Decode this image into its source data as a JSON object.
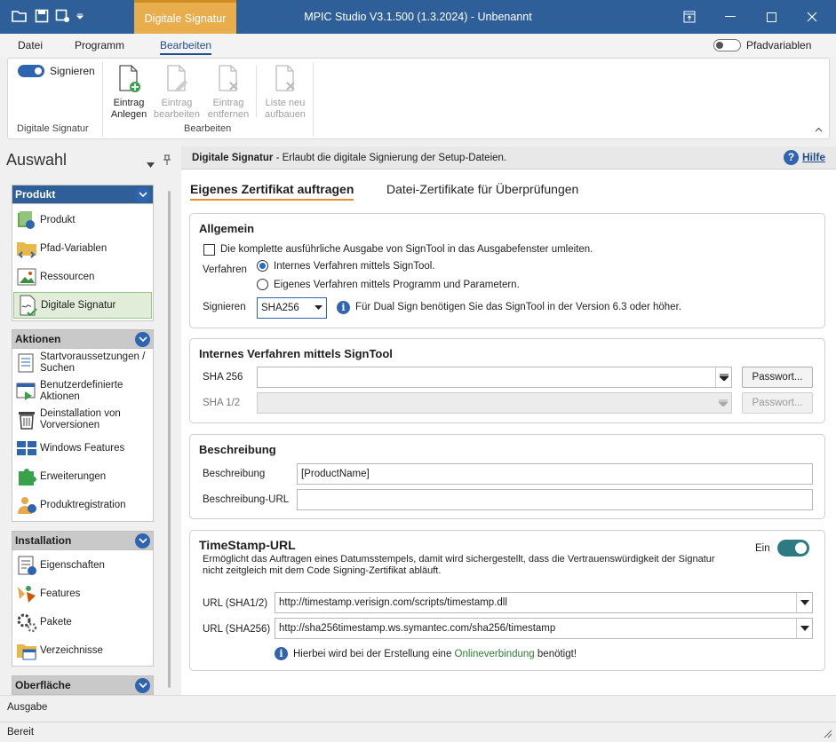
{
  "titlebar": {
    "context_tab": "Digitale Signatur",
    "app_title": "MPIC Studio V3.1.500 (1.3.2024) - Unbenannt"
  },
  "ribbon_tabs": [
    "Datei",
    "Programm",
    "Bearbeiten"
  ],
  "pfadvariablen_label": "Pfadvariablen",
  "ribbon": {
    "signieren_label": "Signieren",
    "group1_label": "Digitale Signatur",
    "group2_label": "Bearbeiten",
    "buttons": [
      {
        "line1": "Eintrag",
        "line2": "Anlegen"
      },
      {
        "line1": "Eintrag",
        "line2": "bearbeiten"
      },
      {
        "line1": "Eintrag",
        "line2": "entfernen"
      },
      {
        "line1": "Liste neu",
        "line2": "aufbauen"
      }
    ]
  },
  "left": {
    "title": "Auswahl",
    "pin": "⬆",
    "sections": [
      {
        "title": "Produkt",
        "items": [
          "Produkt",
          "Pfad-Variablen",
          "Ressourcen",
          "Digitale Signatur"
        ]
      },
      {
        "title": "Aktionen",
        "items": [
          "Startvoraussetzungen / Suchen",
          "Benutzerdefinierte Aktionen",
          "Deinstallation von Vorversionen",
          "Windows Features",
          "Erweiterungen",
          "Produktregistration"
        ]
      },
      {
        "title": "Installation",
        "items": [
          "Eigenschaften",
          "Features",
          "Pakete",
          "Verzeichnisse"
        ]
      },
      {
        "title": "Oberfläche",
        "items": []
      }
    ]
  },
  "main": {
    "header_bold": "Digitale Signatur",
    "header_text": " - Erlaubt die digitale Signierung der Setup-Dateien.",
    "help": "Hilfe",
    "tabs": [
      "Eigenes Zertifikat auftragen",
      "Datei-Zertifikate für Überprüfungen"
    ],
    "allgemein": {
      "title": "Allgemein",
      "checkbox": "Die komplette ausführliche Ausgabe von SignTool in das Ausgabefenster umleiten.",
      "verfahren_label": "Verfahren",
      "radio1": "Internes Verfahren mittels SignTool.",
      "radio2": "Eigenes Verfahren mittels Programm und Parametern.",
      "signieren_label": "Signieren",
      "signieren_value": "SHA256",
      "signieren_info": "Für Dual Sign benötigen Sie das SignTool in der Version 6.3 oder höher."
    },
    "intern": {
      "title": "Internes Verfahren mittels SignTool",
      "sha256_label": "SHA 256",
      "sha1_label": "SHA 1/2",
      "passwort": "Passwort..."
    },
    "beschreibung": {
      "title": "Beschreibung",
      "label1": "Beschreibung",
      "value1": "[ProductName]",
      "label2": "Beschreibung-URL",
      "value2": ""
    },
    "timestamp": {
      "title": "TimeStamp-URL",
      "desc": "Ermöglicht das Auftragen eines Datumsstempels, damit wird sichergestellt, dass die Vertrauenswürdigkeit der Signatur nicht zeitgleich mit dem Code Signing-Zertifikat abläuft.",
      "ein_label": "Ein",
      "url1_label": "URL (SHA1/2)",
      "url1_value": "http://timestamp.verisign.com/scripts/timestamp.dll",
      "url2_label": "URL (SHA256)",
      "url2_value": "http://sha256timestamp.ws.symantec.com/sha256/timestamp",
      "info_pre": "Hierbei wird bei der Erstellung eine ",
      "info_link": "Onlineverbindung",
      "info_post": " benötigt!"
    }
  },
  "ausgabe": "Ausgabe",
  "status": "Bereit"
}
